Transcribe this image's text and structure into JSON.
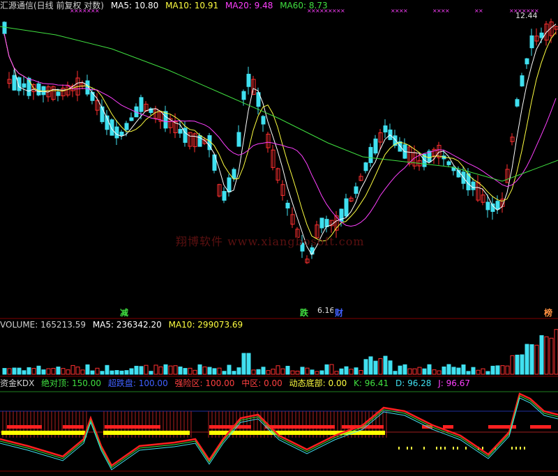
{
  "price_header": {
    "title": "汇源通信(日线 前复权 对数)",
    "ma5": "MA5: 10.80",
    "ma10": "MA10: 10.91",
    "ma20": "MA20: 9.48",
    "ma60": "MA60: 8.73"
  },
  "price_labels": {
    "high": "12.44",
    "low": "6.16"
  },
  "event_tags": {
    "jian": "减",
    "die": "跌",
    "cai": "财",
    "bang": "榜"
  },
  "volume_header": {
    "volume": "VOLUME: 165213.59",
    "ma5": "MA5: 236342.20",
    "ma10": "MA10: 299073.69"
  },
  "kdx_header": {
    "name": "资金KDX",
    "top": "绝对顶: 150.00",
    "ultra_low": "超跌盘: 100.00",
    "strong": "强险区: 100.00",
    "mid": "中区: 0.00",
    "dyn_bottom": "动态底部: 0.00",
    "k": "K: 96.41",
    "d": "D: 96.28",
    "j": "J: 96.67"
  },
  "watermark": "翔博软件 www.xiangbosoft.com",
  "colors": {
    "up": "#ff3030",
    "down": "#40e0f0",
    "ma5": "#ffffff",
    "ma10": "#ffff40",
    "ma20": "#ff40ff",
    "ma60": "#40e040"
  }
}
